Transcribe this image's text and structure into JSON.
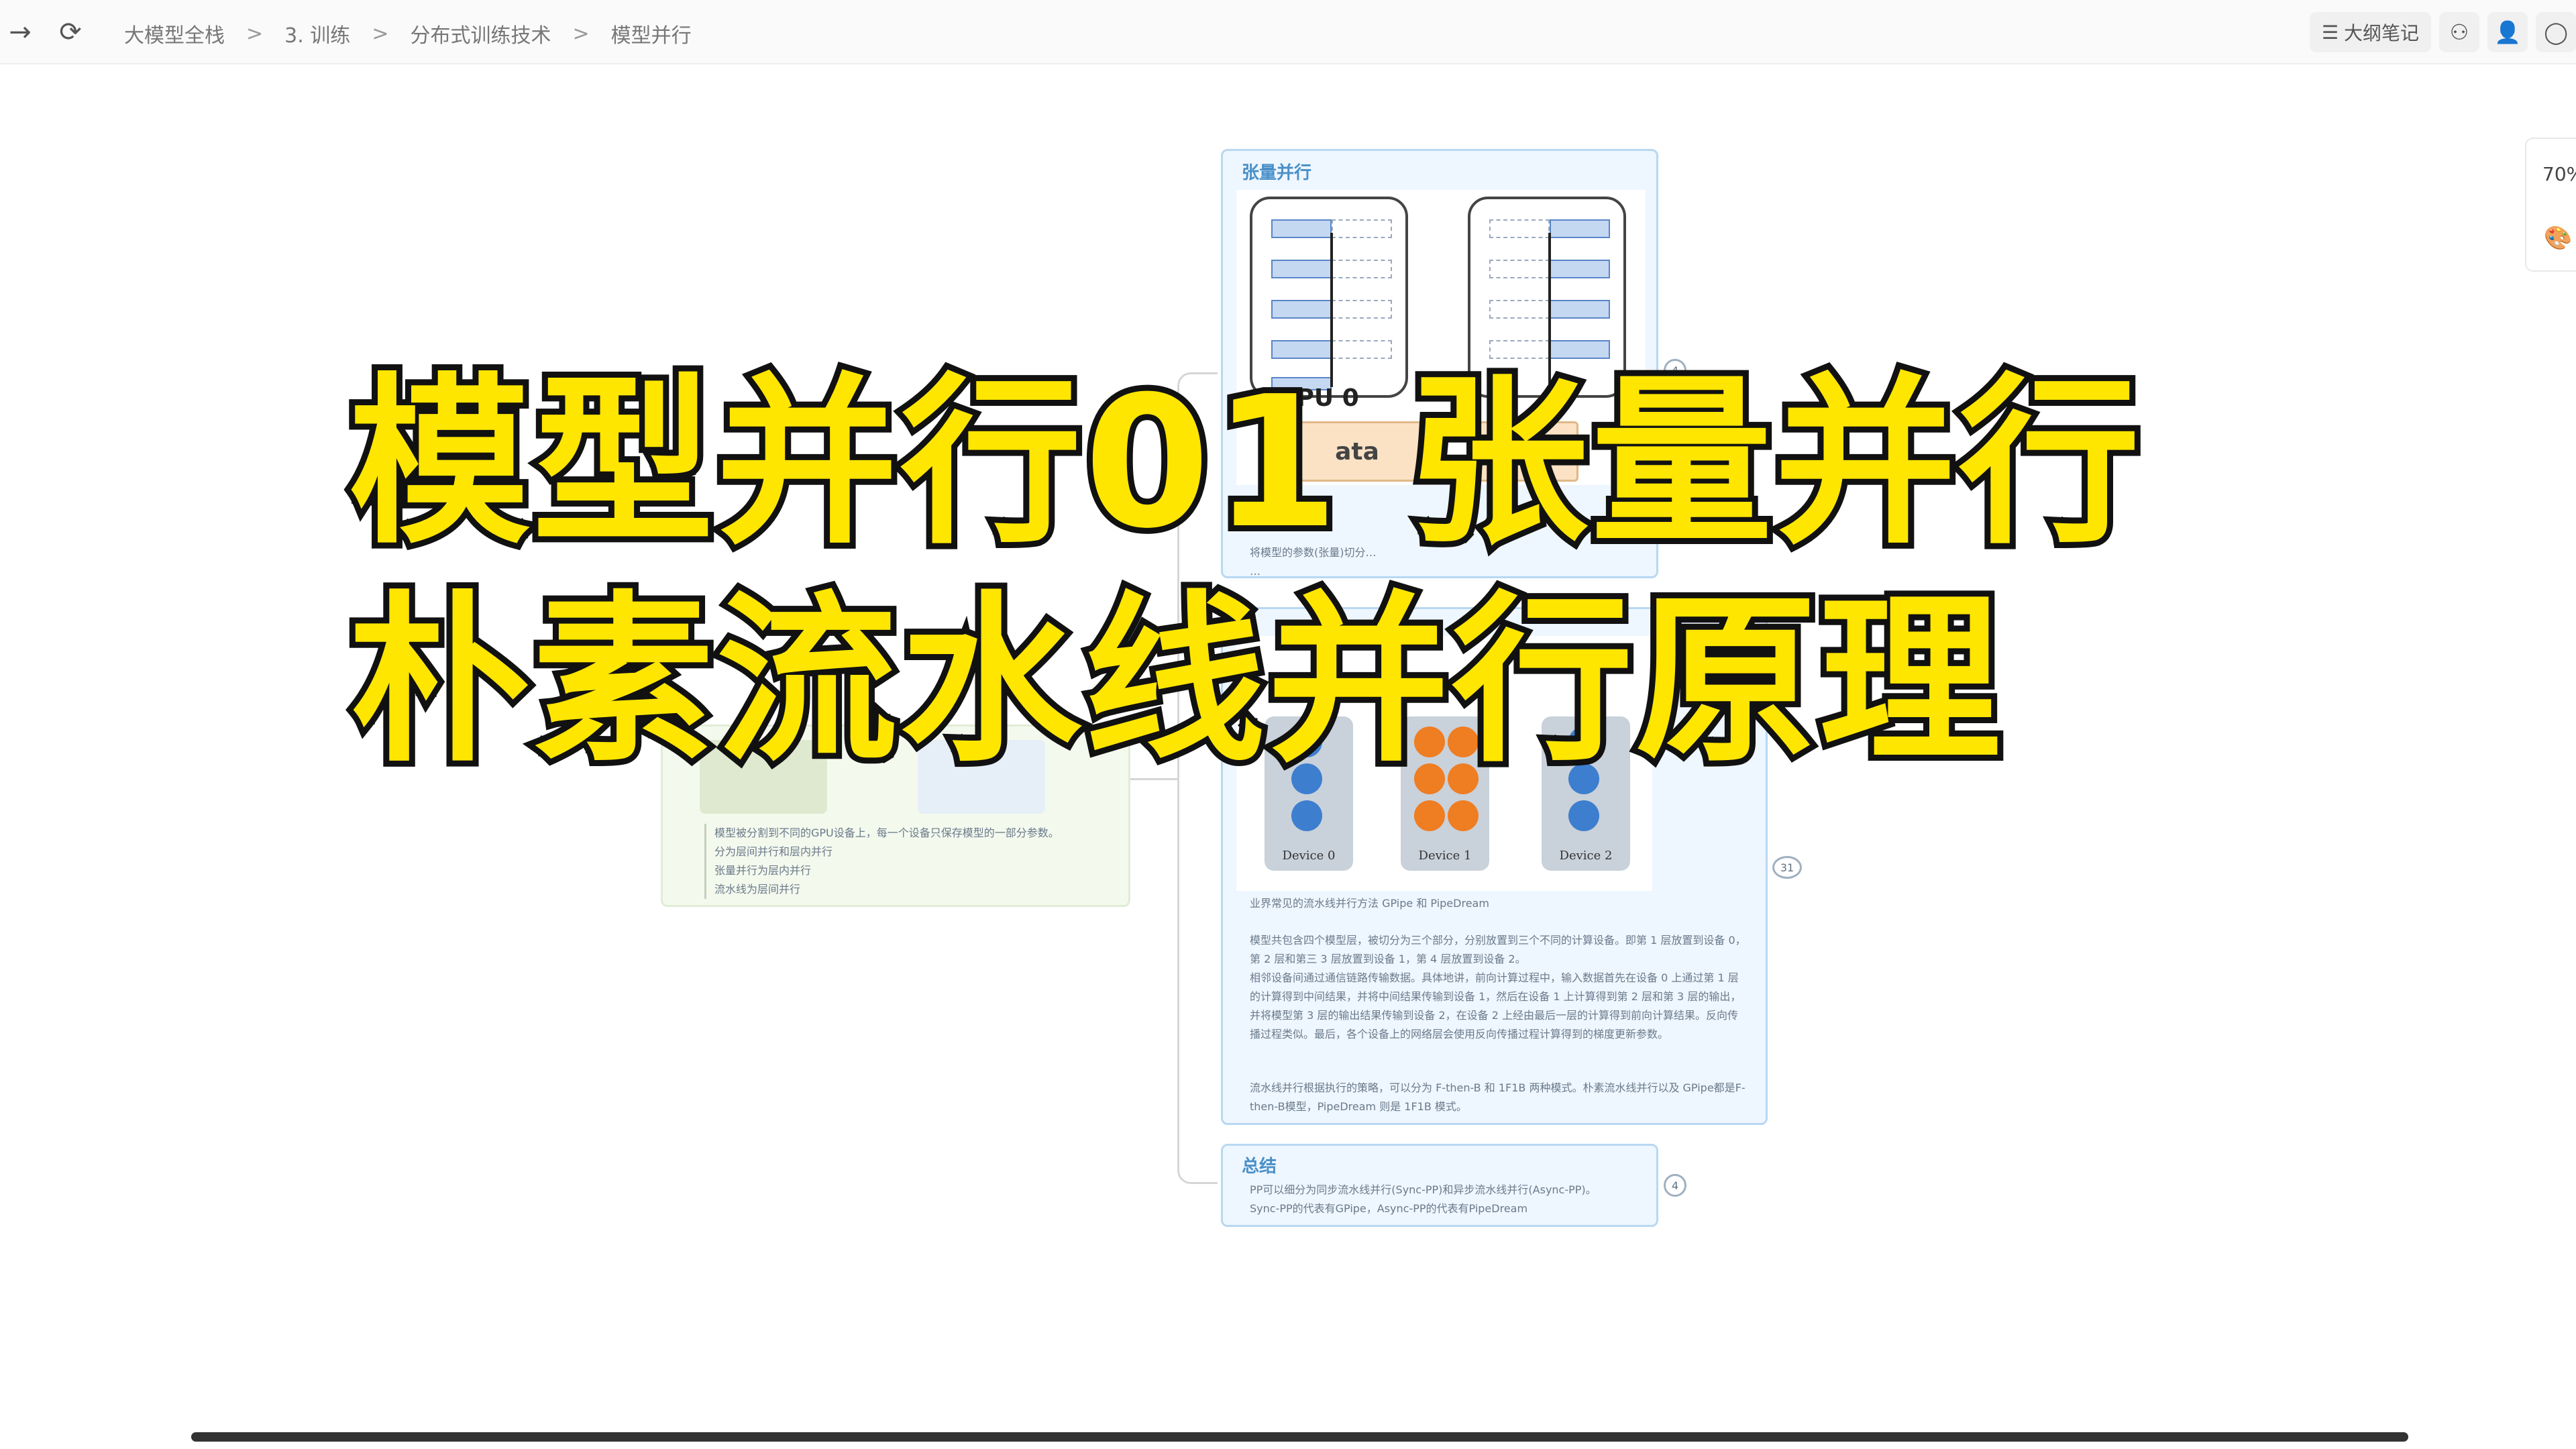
{
  "toolbar": {
    "back_icon": "→",
    "refresh_icon": "⟳",
    "breadcrumb": [
      "大模型全栈",
      "3. 训练",
      "分布式训练技术",
      "模型并行"
    ],
    "breadcrumb_sep": ">",
    "outline_notes_label": "大纲笔记",
    "outline_icon": "☰"
  },
  "zoom": {
    "level": "70%"
  },
  "tensor_card": {
    "title": "张量并行",
    "gpu_label": "GPU 0",
    "data_label": "ata",
    "text": "将模型的参数(张量)切分…\n…",
    "badge": "4"
  },
  "left_card": {
    "text": "模型被分割到不同的GPU设备上，每一个设备只保存模型的一部分参数。\n分为层间并行和层内并行\n张量并行为层内并行\n流水线为层间并行"
  },
  "pipeline_card": {
    "devices": [
      "Device 0",
      "Device 1",
      "Device 2"
    ],
    "badge": "31",
    "text1": "业界常见的流水线并行方法 GPipe 和 PipeDream",
    "text2": "模型共包含四个模型层，被切分为三个部分，分别放置到三个不同的计算设备。即第 1 层放置到设备 0，第 2 层和第三 3 层放置到设备 1，第 4 层放置到设备 2。\n相邻设备间通过通信链路传输数据。具体地讲，前向计算过程中，输入数据首先在设备 0 上通过第 1 层的计算得到中间结果，并将中间结果传输到设备 1，然后在设备 1 上计算得到第 2 层和第 3 层的输出，并将模型第 3 层的输出结果传输到设备 2，在设备 2 上经由最后一层的计算得到前向计算结果。反向传播过程类似。最后，各个设备上的网络层会使用反向传播过程计算得到的梯度更新参数。",
    "text3": "流水线并行根据执行的策略，可以分为 F-then-B 和 1F1B 两种模式。朴素流水线并行以及 GPipe都是F-then-B模型，PipeDream 则是 1F1B 模式。"
  },
  "summary_card": {
    "title": "总结",
    "text": "PP可以细分为同步流水线并行(Sync-PP)和异步流水线并行(Async-PP)。\nSync-PP的代表有GPipe，Async-PP的代表有PipeDream",
    "badge": "4"
  },
  "overlay": {
    "line1": "模型并行01 张量并行",
    "line2": "朴素流水线并行原理"
  }
}
